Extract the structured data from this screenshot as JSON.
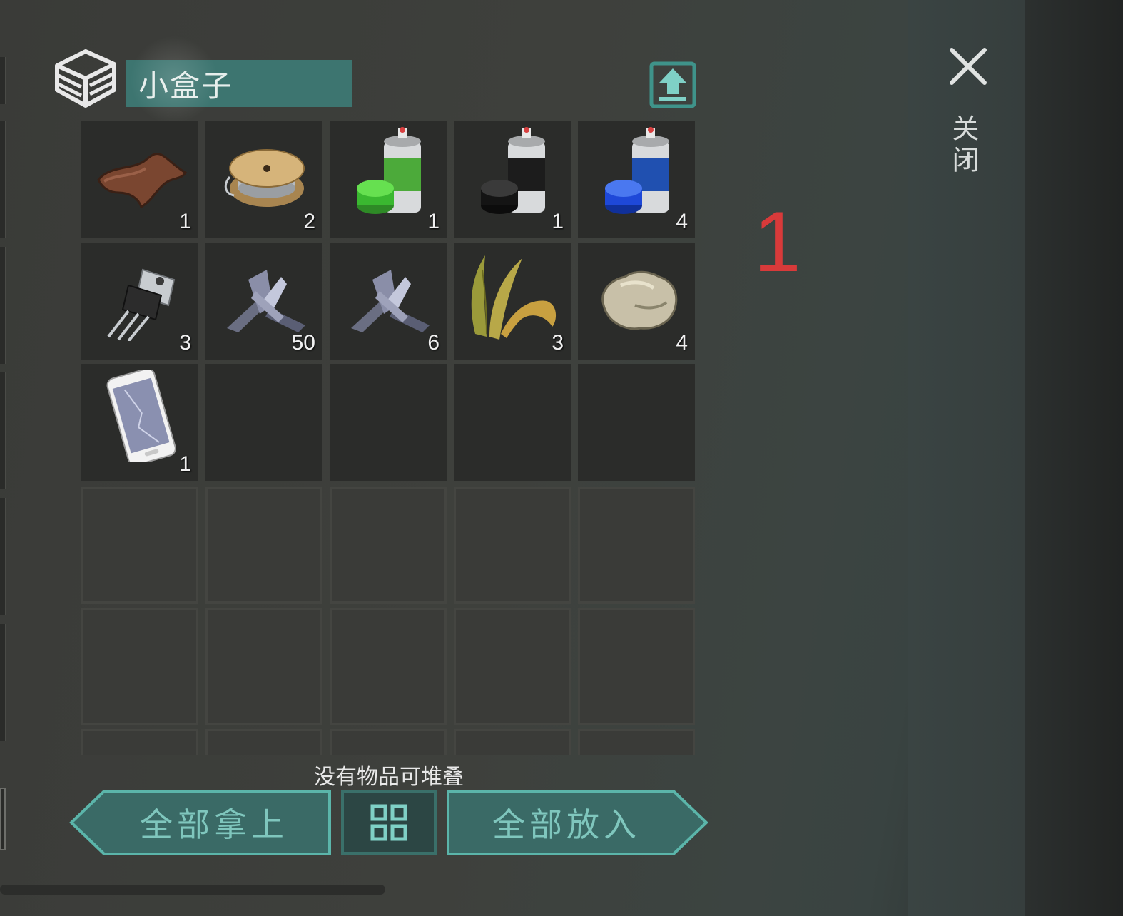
{
  "container": {
    "title": "小盒子",
    "icon": "stacked-box-icon",
    "export_icon": "upload-tray-icon"
  },
  "slots": [
    {
      "item": "leather-icon",
      "count": "1"
    },
    {
      "item": "wire-spool-icon",
      "count": "2"
    },
    {
      "item": "green-spray-paint-icon",
      "count": "1"
    },
    {
      "item": "black-spray-paint-icon",
      "count": "1"
    },
    {
      "item": "blue-spray-paint-icon",
      "count": "4"
    },
    {
      "item": "transistor-icon",
      "count": "3"
    },
    {
      "item": "metal-scrap-icon",
      "count": "50"
    },
    {
      "item": "metal-scrap-icon",
      "count": "6"
    },
    {
      "item": "plant-fiber-icon",
      "count": "3"
    },
    {
      "item": "stone-icon",
      "count": "4"
    },
    {
      "item": "smartphone-icon",
      "count": "1"
    }
  ],
  "annotation_number": "1",
  "close": {
    "label": "关闭",
    "icon": "close-icon"
  },
  "footer": {
    "stack_message": "没有物品可堆叠",
    "take_all_label": "全部拿上",
    "sort_icon": "sort-grid-icon",
    "put_all_label": "全部放入"
  },
  "colors": {
    "accent": "#3d7570",
    "button_text": "#7fc6bd",
    "annotation": "#d83a3a"
  }
}
